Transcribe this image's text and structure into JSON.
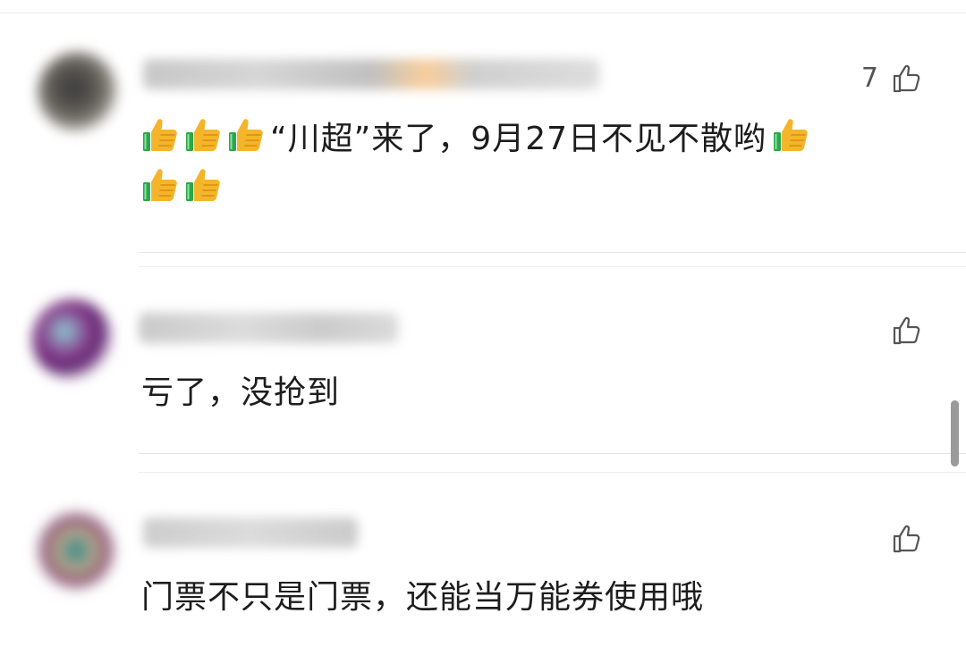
{
  "comments": [
    {
      "like_count": "7",
      "text_before": "“川超”来了，9月27日不见不散哟",
      "emoji": "thumbs-up"
    },
    {
      "like_count": "",
      "text": "亏了，没抢到"
    },
    {
      "like_count": "",
      "text": "门票不只是门票，还能当万能券使用哦"
    }
  ],
  "colors": {
    "text": "#1d1d1d",
    "icon": "#555555",
    "divider": "#e6e6e6",
    "thumb_yellow": "#f5b52a",
    "thumb_green": "#2ba84a"
  },
  "icons": {
    "like": "thumb-up-outline-icon",
    "emoji": "thumbs-up-emoji-icon"
  }
}
